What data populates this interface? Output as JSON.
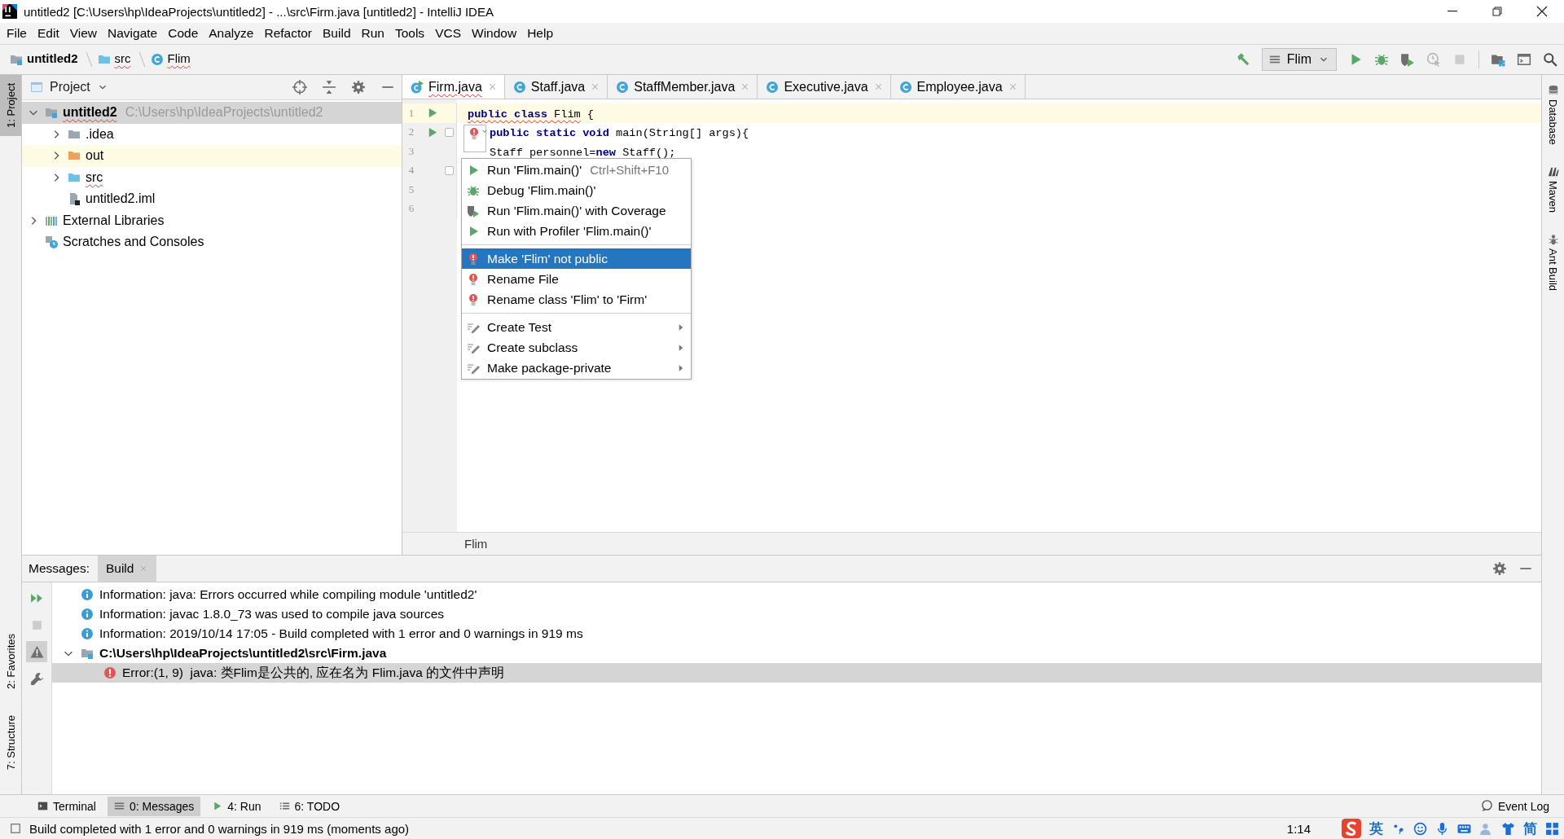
{
  "window": {
    "title": "untitled2 [C:\\Users\\hp\\IdeaProjects\\untitled2] - ...\\src\\Firm.java [untitled2] - IntelliJ IDEA"
  },
  "menu": [
    "File",
    "Edit",
    "View",
    "Navigate",
    "Code",
    "Analyze",
    "Refactor",
    "Build",
    "Run",
    "Tools",
    "VCS",
    "Window",
    "Help"
  ],
  "breadcrumbs": [
    {
      "label": "untitled2",
      "kind": "module",
      "error": false
    },
    {
      "label": "src",
      "kind": "source",
      "error": true
    },
    {
      "label": "Flim",
      "kind": "class",
      "error": true
    }
  ],
  "toolbar": [
    {
      "kind": "build",
      "disabled": false
    },
    {
      "kind": "run_config",
      "label": "Flim",
      "disabled": false
    },
    {
      "kind": "run",
      "disabled": false
    },
    {
      "kind": "debug",
      "disabled": false
    },
    {
      "kind": "coverage",
      "disabled": false
    },
    {
      "kind": "profiler",
      "disabled": true
    },
    {
      "kind": "stop",
      "disabled": true
    },
    {
      "kind": "project_structure",
      "disabled": false
    },
    {
      "kind": "window",
      "disabled": false
    },
    {
      "kind": "search",
      "disabled": false
    }
  ],
  "left_stripe": {
    "top": [
      {
        "label": "1: Project",
        "selected": true
      }
    ],
    "bottom": [
      {
        "label": "2: Favorites",
        "selected": false
      },
      {
        "label": "7: Structure",
        "selected": false
      }
    ]
  },
  "right_stripe": [
    {
      "label": "Database",
      "kind": "database"
    },
    {
      "label": "Maven",
      "kind": "maven"
    },
    {
      "label": "Ant Build",
      "kind": "ant"
    }
  ],
  "project": {
    "title": "Project",
    "tree": [
      {
        "label": "untitled2",
        "path": "C:\\Users\\hp\\IdeaProjects\\untitled2",
        "kind": "module",
        "expanded": true,
        "selected": true,
        "highlighted": false,
        "error": true,
        "children": [
          {
            "label": ".idea",
            "kind": "folder",
            "expanded": false,
            "selected": false,
            "highlighted": false,
            "error": false
          },
          {
            "label": "out",
            "kind": "excluded",
            "expanded": false,
            "selected": false,
            "highlighted": true,
            "error": false
          },
          {
            "label": "src",
            "kind": "source",
            "expanded": false,
            "selected": false,
            "highlighted": false,
            "error": true
          },
          {
            "label": "untitled2.iml",
            "kind": "iml",
            "selected": false,
            "highlighted": false,
            "error": false
          }
        ]
      },
      {
        "label": "External Libraries",
        "kind": "libraries",
        "expanded": false,
        "selected": false,
        "highlighted": false,
        "error": false
      },
      {
        "label": "Scratches and Consoles",
        "kind": "scratches",
        "selected": false,
        "highlighted": false,
        "error": false
      }
    ]
  },
  "tabs": [
    {
      "label": "Firm.java",
      "kind": "runnable",
      "selected": true,
      "error": true
    },
    {
      "label": "Staff.java",
      "kind": "class",
      "selected": false,
      "error": false
    },
    {
      "label": "StaffMember.java",
      "kind": "class",
      "selected": false,
      "error": false
    },
    {
      "label": "Executive.java",
      "kind": "class",
      "selected": false,
      "error": false
    },
    {
      "label": "Employee.java",
      "kind": "class",
      "selected": false,
      "error": false
    }
  ],
  "code": [
    {
      "number": "1",
      "run": true,
      "fold": false,
      "current": true,
      "kind": "class",
      "tokens": [
        {
          "text": "public class ",
          "kind": "keyword_error"
        },
        {
          "text": "Flim",
          "kind": "plain_error"
        },
        {
          "text": " {",
          "kind": "plain"
        }
      ]
    },
    {
      "number": "2",
      "run": true,
      "fold": true,
      "current": false,
      "kind": "body",
      "tokens": [
        {
          "text": "public static void",
          "kind": "keyword"
        },
        {
          "text": " main(String[] args){",
          "kind": "plain"
        }
      ]
    },
    {
      "number": "3",
      "run": false,
      "fold": false,
      "current": false,
      "kind": "body",
      "tokens": [
        {
          "text": "Staff personnel=",
          "kind": "plain"
        },
        {
          "text": "new",
          "kind": "keyword"
        },
        {
          "text": " Staff();",
          "kind": "plain"
        }
      ]
    },
    {
      "number": "4",
      "run": false,
      "fold": true,
      "current": false
    },
    {
      "number": "5",
      "run": false,
      "fold": false,
      "current": false
    },
    {
      "number": "6",
      "run": false,
      "fold": false,
      "current": false
    }
  ],
  "editor_breadcrumb": "Flim",
  "context_menu": [
    [
      {
        "label": "Run 'Flim.main()'",
        "shortcut": "Ctrl+Shift+F10",
        "kind": "run",
        "selected": false,
        "submenu": false
      },
      {
        "label": "Debug 'Flim.main()'",
        "kind": "debug",
        "selected": false,
        "submenu": false
      },
      {
        "label": "Run 'Flim.main()' with Coverage",
        "kind": "coverage",
        "selected": false,
        "submenu": false
      },
      {
        "label": "Run with Profiler 'Flim.main()'",
        "kind": "run",
        "selected": false,
        "submenu": false
      }
    ],
    [
      {
        "label": "Make 'Flim' not public",
        "kind": "bulb",
        "selected": true,
        "submenu": false
      },
      {
        "label": "Rename File",
        "kind": "bulb",
        "selected": false,
        "submenu": false
      },
      {
        "label": "Rename class 'Flim' to 'Firm'",
        "kind": "bulb",
        "selected": false,
        "submenu": false
      }
    ],
    [
      {
        "label": "Create Test",
        "kind": "edit",
        "selected": false,
        "submenu": true
      },
      {
        "label": "Create subclass",
        "kind": "edit",
        "selected": false,
        "submenu": true
      },
      {
        "label": "Make package-private",
        "kind": "edit",
        "selected": false,
        "submenu": true
      }
    ]
  ],
  "messages": {
    "label": "Messages:",
    "tabs": [
      {
        "label": "Build",
        "selected": true
      }
    ],
    "toolbar": [
      {
        "kind": "rerun",
        "selected": false,
        "disabled": false
      },
      {
        "kind": "stop",
        "selected": false,
        "disabled": true
      },
      {
        "kind": "warning",
        "selected": true,
        "disabled": false
      },
      {
        "kind": "wrench",
        "selected": false,
        "disabled": false
      }
    ],
    "rows": [
      {
        "kind": "info",
        "text": "Information: java: Errors occurred while compiling module 'untitled2'",
        "selected": false
      },
      {
        "kind": "info",
        "text": "Information: javac 1.8.0_73 was used to compile java sources",
        "selected": false
      },
      {
        "kind": "info",
        "text": "Information: 2019/10/14 17:05 - Build completed with 1 error and 0 warnings in 919 ms",
        "selected": false
      },
      {
        "kind": "file",
        "text": "C:\\Users\\hp\\IdeaProjects\\untitled2\\src\\Firm.java",
        "selected": false,
        "expanded": true,
        "children": [
          {
            "kind": "error",
            "text": "Error:(1, 9)  java: 类Flim是公共的, 应在名为 Flim.java 的文件中声明",
            "selected": true
          }
        ]
      }
    ]
  },
  "bottom_tabs": [
    {
      "label": "Terminal",
      "kind": "terminal",
      "selected": false
    },
    {
      "label": "0: Messages",
      "kind": "messages",
      "selected": true
    },
    {
      "label": "4: Run",
      "kind": "run",
      "selected": false
    },
    {
      "label": "6: TODO",
      "kind": "todo",
      "selected": false
    }
  ],
  "event_log": "Event Log",
  "status": {
    "text": "Build completed with 1 error and 0 warnings in 919 ms (moments ago)",
    "position": "1:14",
    "tray": [
      {
        "kind": "sogou"
      },
      {
        "kind": "text",
        "label": "英"
      },
      {
        "kind": "punct"
      },
      {
        "kind": "emoji"
      },
      {
        "kind": "mic"
      },
      {
        "kind": "keyboard"
      },
      {
        "kind": "user"
      },
      {
        "kind": "shirt"
      },
      {
        "kind": "text",
        "label": "简"
      },
      {
        "kind": "grid"
      }
    ]
  }
}
